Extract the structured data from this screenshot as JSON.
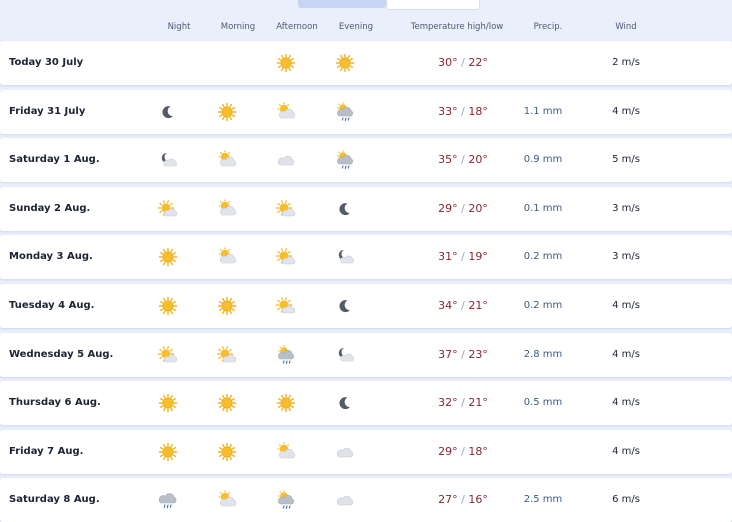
{
  "columns": {
    "night": "Night",
    "morning": "Morning",
    "afternoon": "Afternoon",
    "evening": "Evening",
    "temperature": "Temperature high/low",
    "precip": "Precip.",
    "wind": "Wind"
  },
  "colors": {
    "high_temp": "#8b2231",
    "precip": "#3a5a86",
    "sun": "#f5b21b",
    "cloud": "#d9dde5"
  },
  "rows": [
    {
      "day": "Today 30 July",
      "night": "",
      "morning": "",
      "afternoon": "sun",
      "evening": "sun",
      "high": "30°",
      "low": "22°",
      "precip": "",
      "wind": "2 m/s"
    },
    {
      "day": "Friday 31 July",
      "night": "moon",
      "morning": "sun",
      "afternoon": "sun-cloud",
      "evening": "sun-cloud-rain",
      "high": "33°",
      "low": "18°",
      "precip": "1.1 mm",
      "wind": "4 m/s"
    },
    {
      "day": "Saturday 1 Aug.",
      "night": "moon-cloud",
      "morning": "sun-cloud",
      "afternoon": "cloud",
      "evening": "sun-cloud-rain",
      "high": "35°",
      "low": "20°",
      "precip": "0.9 mm",
      "wind": "5 m/s"
    },
    {
      "day": "Sunday 2 Aug.",
      "night": "sun-cloud-small",
      "morning": "sun-cloud",
      "afternoon": "sun-cloud-small",
      "evening": "moon",
      "high": "29°",
      "low": "20°",
      "precip": "0.1 mm",
      "wind": "3 m/s"
    },
    {
      "day": "Monday 3 Aug.",
      "night": "sun",
      "morning": "sun-cloud",
      "afternoon": "sun-cloud-small",
      "evening": "moon-cloud",
      "high": "31°",
      "low": "19°",
      "precip": "0.2 mm",
      "wind": "3 m/s"
    },
    {
      "day": "Tuesday 4 Aug.",
      "night": "sun",
      "morning": "sun",
      "afternoon": "sun-cloud-small",
      "evening": "moon",
      "high": "34°",
      "low": "21°",
      "precip": "0.2 mm",
      "wind": "4 m/s"
    },
    {
      "day": "Wednesday 5 Aug.",
      "night": "sun-cloud-small",
      "morning": "sun-cloud-small",
      "afternoon": "sun-cloud-rain",
      "evening": "moon-cloud",
      "high": "37°",
      "low": "23°",
      "precip": "2.8 mm",
      "wind": "4 m/s"
    },
    {
      "day": "Thursday 6 Aug.",
      "night": "sun",
      "morning": "sun",
      "afternoon": "sun",
      "evening": "moon",
      "high": "32°",
      "low": "21°",
      "precip": "0.5 mm",
      "wind": "4 m/s"
    },
    {
      "day": "Friday 7 Aug.",
      "night": "sun",
      "morning": "sun",
      "afternoon": "sun-cloud",
      "evening": "cloud",
      "high": "29°",
      "low": "18°",
      "precip": "",
      "wind": "4 m/s"
    },
    {
      "day": "Saturday 8 Aug.",
      "night": "cloud-rain",
      "morning": "sun-cloud",
      "afternoon": "sun-cloud-rain",
      "evening": "cloud",
      "high": "27°",
      "low": "16°",
      "precip": "2.5 mm",
      "wind": "6 m/s"
    }
  ]
}
